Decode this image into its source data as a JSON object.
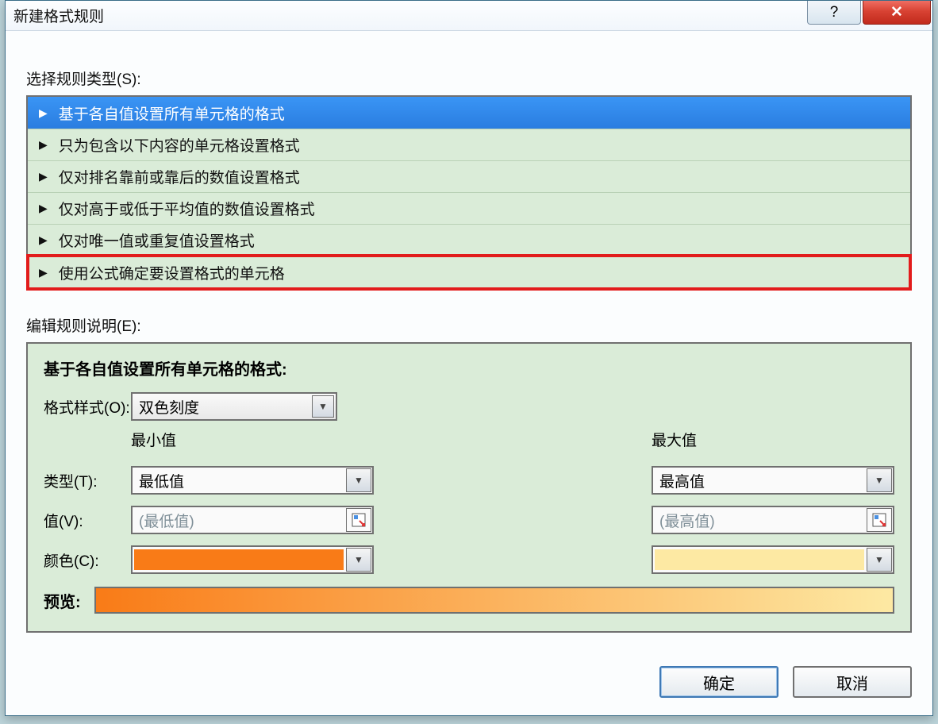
{
  "window": {
    "title": "新建格式规则"
  },
  "section": {
    "select_rule_label": "选择规则类型(S):",
    "edit_rule_label": "编辑规则说明(E):"
  },
  "rules": [
    "基于各自值设置所有单元格的格式",
    "只为包含以下内容的单元格设置格式",
    "仅对排名靠前或靠后的数值设置格式",
    "仅对高于或低于平均值的数值设置格式",
    "仅对唯一值或重复值设置格式",
    "使用公式确定要设置格式的单元格"
  ],
  "panel": {
    "title": "基于各自值设置所有单元格的格式:",
    "format_style_label": "格式样式(O):",
    "format_style_value": "双色刻度",
    "min_header": "最小值",
    "max_header": "最大值",
    "type_label": "类型(T):",
    "type_min": "最低值",
    "type_max": "最高值",
    "value_label": "值(V):",
    "value_min_placeholder": "(最低值)",
    "value_max_placeholder": "(最高值)",
    "color_label": "颜色(C):",
    "preview_label": "预览:",
    "colors": {
      "min": "#f97b17",
      "max": "#fde9a3"
    }
  },
  "buttons": {
    "ok": "确定",
    "cancel": "取消"
  }
}
